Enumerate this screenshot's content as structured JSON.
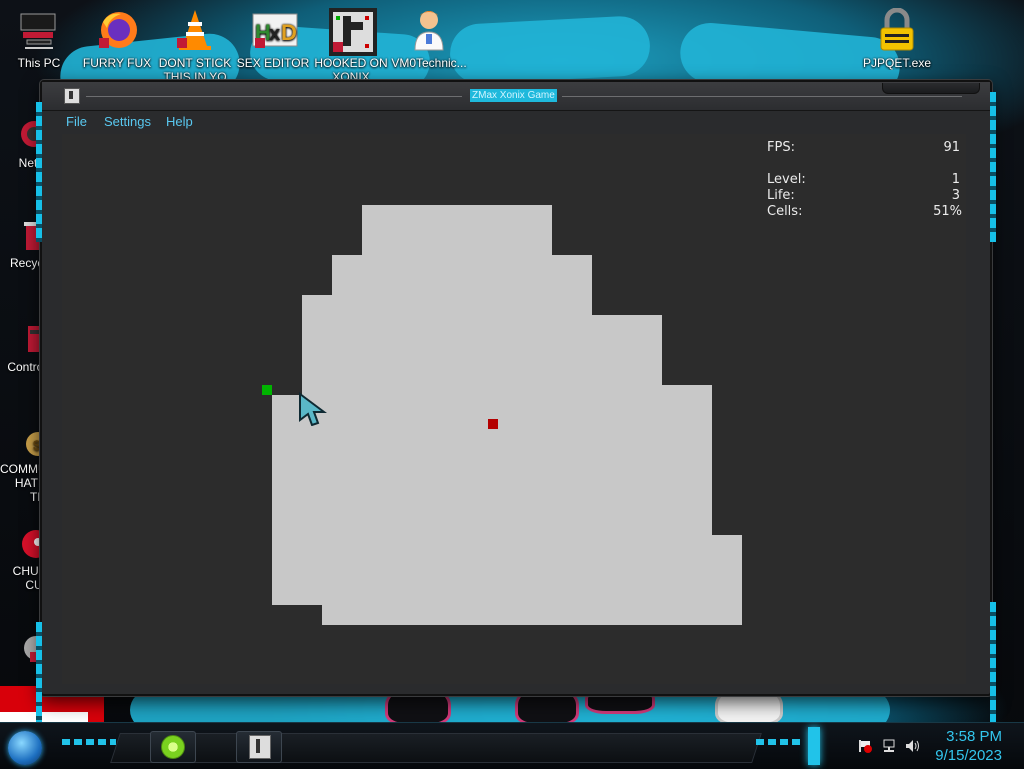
{
  "desktop": {
    "top_icons": [
      {
        "label": "This PC",
        "label2": "",
        "icon": "computer-icon"
      },
      {
        "label": "FURRY FUX",
        "label2": "",
        "icon": "firefox-icon"
      },
      {
        "label": "DONT STICK",
        "label2": "THIS IN YO",
        "icon": "vlc-cone-icon"
      },
      {
        "label": "SEX EDITOR",
        "label2": "",
        "icon": "hxd-editor-icon"
      },
      {
        "label": "HOOKED ON",
        "label2": "XONIX",
        "icon": "xonix-icon"
      },
      {
        "label": "VM0Technic...",
        "label2": "",
        "icon": "doctor-icon"
      },
      {
        "label": "PJPQET.exe",
        "label2": "",
        "icon": "padlock-icon"
      }
    ],
    "left_icons": [
      {
        "label": "Netw",
        "label2": "",
        "icon": "network-icon"
      },
      {
        "label": "Recycl",
        "label2": "",
        "icon": "recycle-bin-icon"
      },
      {
        "label": "Control",
        "label2": "",
        "icon": "control-panel-icon"
      },
      {
        "label": "COMMU",
        "label2": "HATE TH",
        "icon": "money-bag-icon"
      },
      {
        "label": "CHUZ",
        "label2": "CUI",
        "icon": "red-face-icon"
      },
      {
        "label": "",
        "label2": "",
        "icon": "shortcut-icon"
      }
    ]
  },
  "window": {
    "title": "ZMax Xonix Game",
    "menu": [
      "File",
      "Settings",
      "Help"
    ]
  },
  "game": {
    "hud": {
      "fps_label": "FPS:",
      "fps_value": "91",
      "level_label": "Level:",
      "level_value": "1",
      "life_label": "Life:",
      "life_value": "3",
      "cells_label": "Cells:",
      "cells_value": "51%"
    },
    "colors": {
      "filled": "#c8c8c8",
      "empty": "#2c2c2c",
      "player": "#00b400",
      "enemy": "#b40000"
    }
  },
  "taskbar": {
    "time": "3:58 PM",
    "date": "9/15/2023",
    "pinned": [
      "lime-app-icon",
      "xonix-taskbar-icon"
    ],
    "tray": [
      "flag-icon",
      "network-tray-icon",
      "volume-icon"
    ]
  }
}
